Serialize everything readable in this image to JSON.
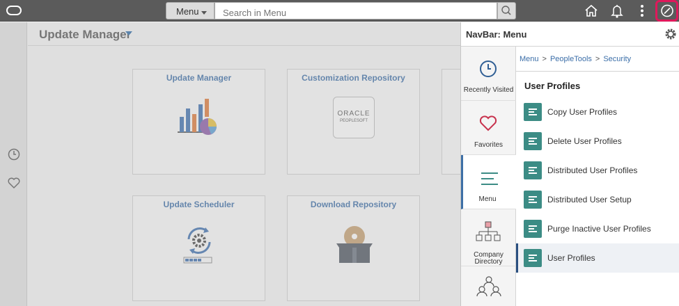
{
  "topbar": {
    "menu_label": "Menu",
    "search_placeholder": "Search in Menu",
    "icons": [
      "home-icon",
      "bell-icon",
      "more-vertical-icon",
      "compass-icon"
    ]
  },
  "leftrail": {
    "icons": [
      "clock-icon",
      "heart-icon"
    ]
  },
  "page": {
    "title": "Update Manager"
  },
  "tiles": [
    {
      "title": "Update Manager"
    },
    {
      "title": "Customization Repository",
      "logo_line1": "ORACLE",
      "logo_line2": "PEOPLESOFT"
    },
    {
      "title": "Update Scheduler"
    },
    {
      "title": "Download Repository"
    }
  ],
  "navbar": {
    "title": "NavBar: Menu",
    "tabs": [
      {
        "label": "Recently Visited"
      },
      {
        "label": "Favorites"
      },
      {
        "label": "Menu"
      },
      {
        "label1": "Company",
        "label2": "Directory"
      }
    ],
    "breadcrumb": [
      "Menu",
      "PeopleTools",
      "Security"
    ],
    "section_title": "User Profiles",
    "items": [
      {
        "label": "Copy User Profiles"
      },
      {
        "label": "Delete User Profiles"
      },
      {
        "label": "Distributed User Profiles"
      },
      {
        "label": "Distributed User Setup"
      },
      {
        "label": "Purge Inactive User Profiles"
      },
      {
        "label": "User Profiles"
      }
    ],
    "selected_item": "User Profiles"
  },
  "colors": {
    "accent": "#3b6ea8",
    "item_icon": "#3c8c85",
    "highlight": "#e0185b",
    "topbar": "#5b5b5b"
  }
}
